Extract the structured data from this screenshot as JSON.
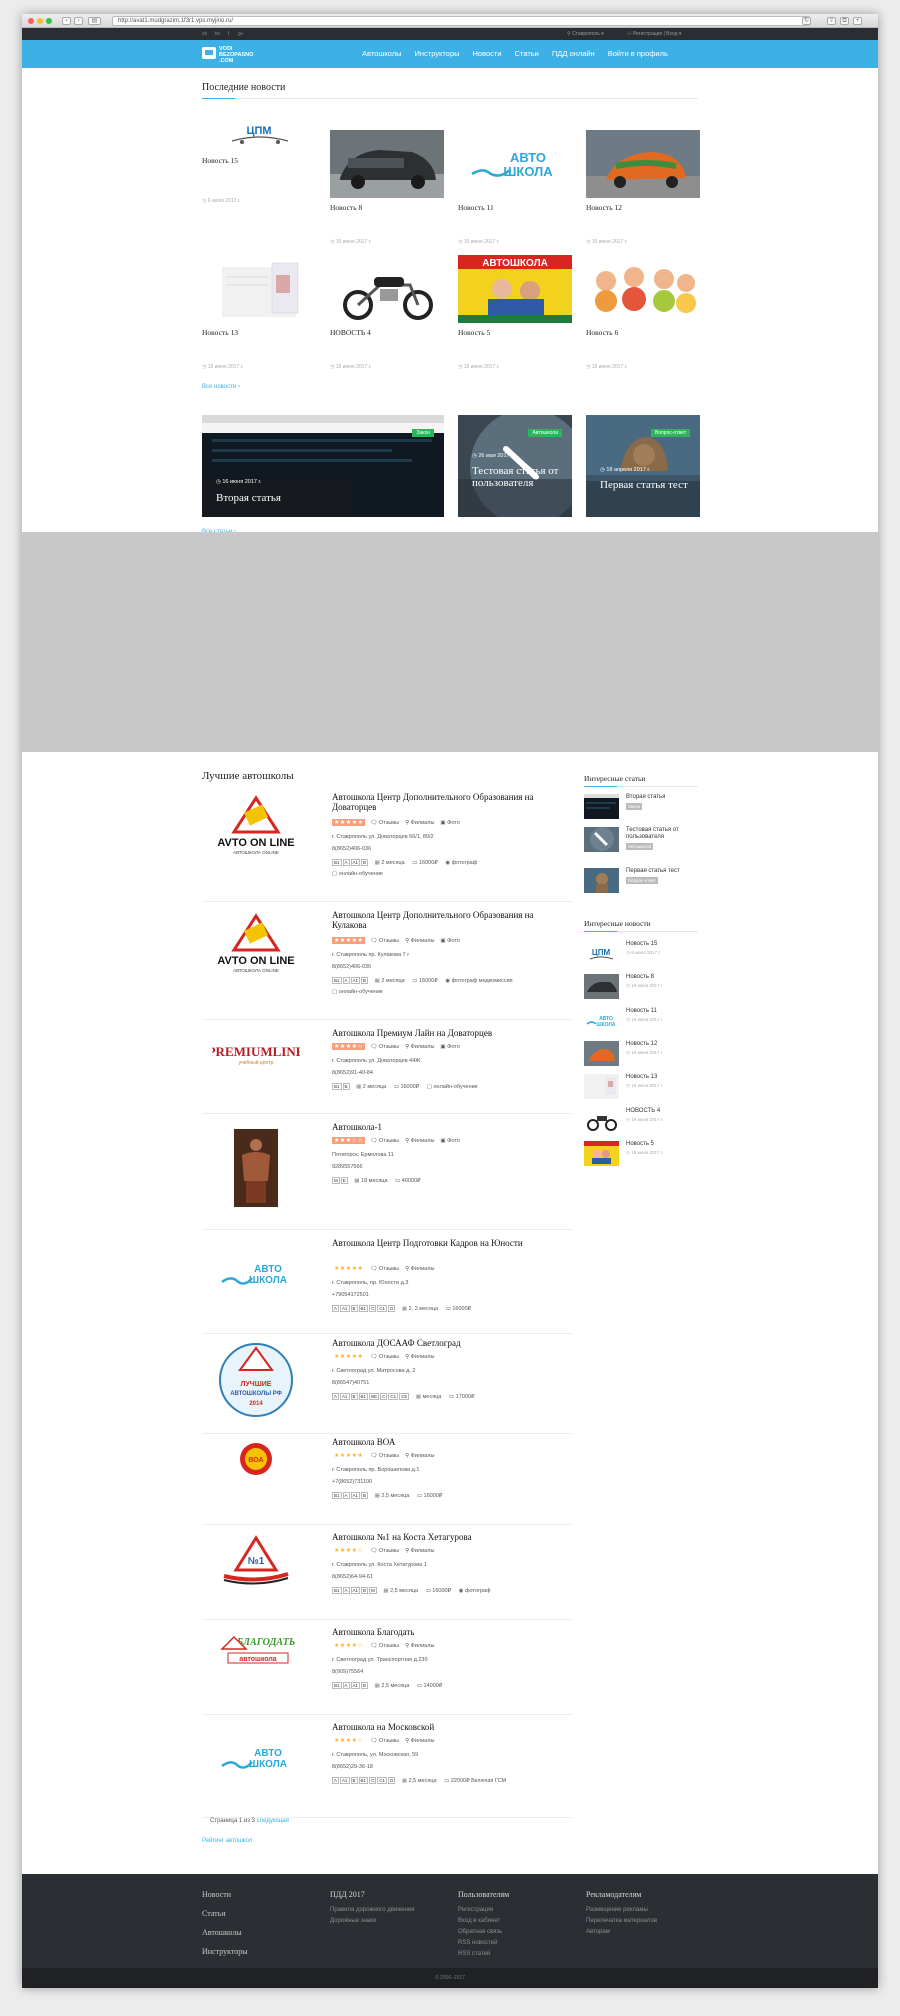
{
  "browser": {
    "url": "http://avat1.mudgrazim.1f3r1.vps.myjino.ru/"
  },
  "topbar": {
    "social": [
      "vk",
      "tw",
      "f",
      "g+"
    ],
    "region": "Ставрополь",
    "login": "Регистрация | Вход"
  },
  "header": {
    "logo_line1": "VODI",
    "logo_line2": "BEZOPASNO",
    "logo_line3": ".COM",
    "nav": [
      "Автошколы",
      "Инструкторы",
      "Новости",
      "Статьи",
      "ПДД онлайн",
      "Войти в профиль"
    ]
  },
  "news": {
    "title": "Последние новости",
    "items": [
      {
        "title": "Новость 15",
        "date": "6 июля 2017 г."
      },
      {
        "title": "Новость 8",
        "date": "19 июня 2017 г."
      },
      {
        "title": "Новость 11",
        "date": "19 июня 2017 г."
      },
      {
        "title": "Новость 12",
        "date": "19 июня 2017 г."
      },
      {
        "title": "Новость 13",
        "date": "19 июня 2017 г."
      },
      {
        "title": "НОВОСТЬ 4",
        "date": "19 июня 2017 г."
      },
      {
        "title": "Новость 5",
        "date": "19 июня 2017 г."
      },
      {
        "title": "Новость 6",
        "date": "19 июня 2017 г."
      }
    ],
    "all_link": "Все новости ›",
    "logo_cpm": "ЦПМ",
    "logo_avto1": "АВТО",
    "logo_avto2": "ШКОЛА",
    "banner_text": "АВТОШКОЛА"
  },
  "articles": {
    "items": [
      {
        "badge": "Закон",
        "date": "16 июня 2017 г.",
        "title": "Вторая статья"
      },
      {
        "badge": "Автошкола",
        "date": "26 мая 2017 г.",
        "title": "Тестовая статья от пользователя"
      },
      {
        "badge": "Вопрос-ответ",
        "date": "18 апреля 2017 г.",
        "title": "Первая статья тест"
      }
    ],
    "all_link": "Все статьи ›"
  },
  "schools": {
    "title": "Лучшие автошколы",
    "labels": {
      "reviews": "Отзывы",
      "branches": "Филиалы",
      "photo": "Фото"
    },
    "items": [
      {
        "name": "Автошкола Центр Дополнительного Образования на Доваторцев",
        "stars": "★★★★★",
        "address": "г. Ставрополь ул. Доваторцев 66/1, 80/2",
        "phone": "8(8652)406-036",
        "cats": [
          "B1",
          "A",
          "A1",
          "B"
        ],
        "duration": "2 месяца",
        "price": "16000₽",
        "extras": "фотограф",
        "extra2": "онлайн-обучение",
        "logo1": "AVTO ON LINE",
        "logo2": "АВТОШКОЛА ONLINE"
      },
      {
        "name": "Автошкола Центр Дополнительного Образования на Кулакова",
        "stars": "★★★★★",
        "address": "г. Ставрополь пр. Кулакова 7 г",
        "phone": "8(8652)406-036",
        "cats": [
          "B1",
          "A",
          "A1",
          "B"
        ],
        "duration": "2 месяца",
        "price": "16000₽",
        "extras": "фотограф   медкомиссия",
        "extra2": "онлайн-обучение",
        "logo1": "AVTO ON LINE",
        "logo2": "АВТОШКОЛА ONLINE"
      },
      {
        "name": "Автошкола Премиум Лайн на Доваторцев",
        "stars": "★★★★☆",
        "address": "г. Ставрополь ул. Доваторцев 44Ж",
        "phone": "8(8652)91-40-84",
        "cats": [
          "B1",
          "B"
        ],
        "duration": "2 месяца",
        "price": "16000₽",
        "extras": "онлайн-обучение",
        "logo1": "PREMIUMLINE",
        "logo2": "учебный центр"
      },
      {
        "name": "Автошкола-1",
        "stars": "★★★☆☆",
        "address": "Пятигорск, Ермолова 11",
        "phone": "9289557566",
        "cats": [
          "M",
          "E"
        ],
        "duration": "18 месяца",
        "price": "40000₽"
      },
      {
        "name": "Автошкола Центр Подготовки Кадров на Юности",
        "stars": "★★★★★",
        "address": "г. Ставрополь, пр. Юности д.3",
        "phone": "+79054172501",
        "cats": [
          "A",
          "A1",
          "B",
          "B1",
          "C",
          "C1",
          "D"
        ],
        "duration": "2, 2 месяца",
        "price": "16000₽",
        "logo1": "АВТО",
        "logo2": "ШКОЛА"
      },
      {
        "name": "Автошкола ДОСААФ Светлоград",
        "stars": "★★★★★",
        "address": "г. Светлоград ул. Матросова д. 2",
        "phone": "8(86547)40751",
        "cats": [
          "A",
          "A1",
          "B",
          "B1",
          "BE",
          "C",
          "C1",
          "CE"
        ],
        "duration": "месяца",
        "price": "17000₽",
        "logo1": "ЛУЧШИЕ",
        "logo2": "АВТОШКОЛЫ РФ",
        "logo3": "2014"
      },
      {
        "name": "Автошкола ВОА",
        "stars": "★★★★★",
        "address": "г. Ставрополь пр. Ворошилова д.1",
        "phone": "+7(8652)731100",
        "cats": [
          "B1",
          "A",
          "A1",
          "B"
        ],
        "duration": "2,5 месяца",
        "price": "16000₽",
        "logo1": "ВОА"
      },
      {
        "name": "Автошкола №1 на Коста Хетагурова",
        "stars": "★★★★☆",
        "address": "г. Ставрополь ул. Коста Хетагурова 1",
        "phone": "8(8652)64-94-61",
        "cats": [
          "B1",
          "A",
          "A1",
          "B",
          "M"
        ],
        "duration": "2,5 месяца",
        "price": "16000₽",
        "extras": "фотограф",
        "logo1": "№1"
      },
      {
        "name": "Автошкола Благодать",
        "stars": "★★★★☆",
        "address": "г. Светлоград ул. Транспортная д.23б",
        "phone": "8(909)75564",
        "cats": [
          "B1",
          "A",
          "A1",
          "B"
        ],
        "duration": "2,5 месяца",
        "price": "14000₽",
        "logo1": "БЛАГОДАТЬ",
        "logo2": "автошкола"
      },
      {
        "name": "Автошкола на Московской",
        "stars": "★★★★☆",
        "address": "г. Ставрополь, ул. Московская, 59",
        "phone": "8(8652)29-36-18",
        "cats": [
          "A",
          "A1",
          "B",
          "B1",
          "C",
          "C1",
          "D"
        ],
        "duration": "2,5 месяца",
        "price": "22000₽ Включая ГСМ",
        "logo1": "АВТО",
        "logo2": "ШКОЛА"
      }
    ],
    "pager_prefix": "Страница 1 из 3",
    "pager_next": "следующая",
    "rating_link": "Рейтинг автошкол"
  },
  "sidebar": {
    "articles_title": "Интересные статьи",
    "articles": [
      {
        "title": "Вторая статья",
        "badge": "Закон"
      },
      {
        "title": "Тестовая статья от пользователя",
        "badge": "Автошкола"
      },
      {
        "title": "Первая статья тест",
        "badge": "Вопрос-ответ"
      }
    ],
    "news_title": "Интересные новости",
    "news": [
      {
        "title": "Новость 15",
        "date": "6 июля 2017 г."
      },
      {
        "title": "Новость 8",
        "date": "19 июня 2017 г."
      },
      {
        "title": "Новость 11",
        "date": "19 июня 2017 г."
      },
      {
        "title": "Новость 12",
        "date": "19 июня 2017 г."
      },
      {
        "title": "Новость 13",
        "date": "19 июня 2017 г."
      },
      {
        "title": "НОВОСТЬ 4",
        "date": "19 июня 2017 г."
      },
      {
        "title": "Новость 5",
        "date": "19 июня 2017 г."
      }
    ]
  },
  "footer": {
    "col1": [
      "Новости",
      "Статьи",
      "Автошколы",
      "Инструкторы"
    ],
    "col2_title": "ПДД 2017",
    "col2": [
      "Правила дорожного движения",
      "Дорожные знаки"
    ],
    "col3_title": "Пользователям",
    "col3": [
      "Регистрация",
      "Вход в кабинет",
      "Обратная связь",
      "RSS новостей",
      "RSS статей"
    ],
    "col4_title": "Рекламодателям",
    "col4": [
      "Размещение рекламы",
      "Перепечатка материалов",
      "Авторам"
    ],
    "copyright": "© 2006–2017"
  },
  "colors": {
    "accent": "#3db1e5",
    "dark": "#2b2e33",
    "badge_green": "#2fb45a",
    "rating": "#f7a07f"
  }
}
